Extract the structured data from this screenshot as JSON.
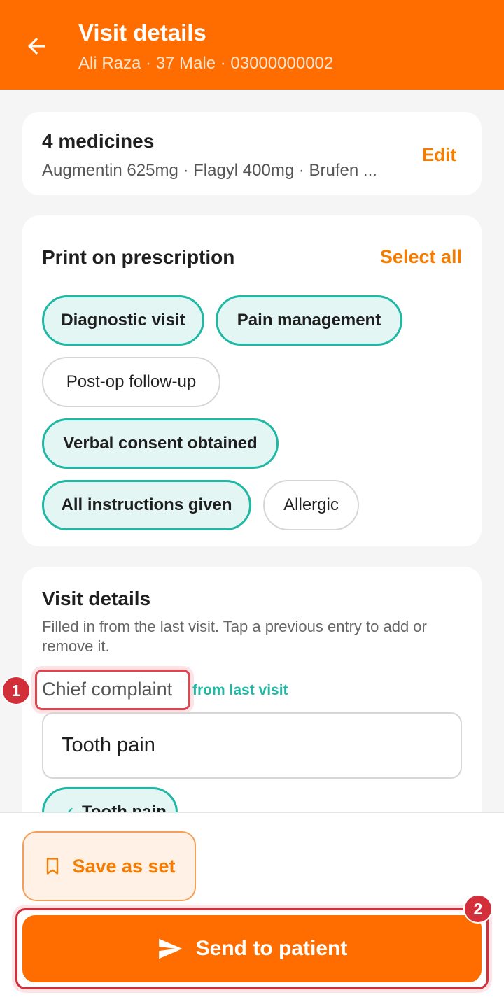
{
  "header": {
    "back_icon": "arrow-left-icon",
    "title": "Visit details",
    "subtitle": "Ali Raza · 37 Male · 03000000002"
  },
  "medicines": {
    "count_label": "4 medicines",
    "list": "Augmentin 625mg · Flagyl 400mg · Brufen ...",
    "edit_label": "Edit"
  },
  "print": {
    "title": "Print on prescription",
    "select_all_label": "Select all",
    "chips": [
      {
        "label": "Diagnostic visit",
        "selected": true
      },
      {
        "label": "Pain management",
        "selected": true
      },
      {
        "label": "Post-op follow-up",
        "selected": false
      },
      {
        "label": "Verbal consent obtained",
        "selected": true
      },
      {
        "label": "All instructions given",
        "selected": true
      },
      {
        "label": "Allergic",
        "selected": false
      }
    ]
  },
  "visit": {
    "title": "Visit details",
    "help": "Filled in from the last visit. Tap a previous entry to add or remove it.",
    "chief_complaint_label": "Chief complaint",
    "from_last_visit": "from last visit",
    "chief_complaint_value": "Tooth pain",
    "previous_entries": [
      {
        "label": "Tooth pain",
        "icon": "check-icon"
      }
    ]
  },
  "actions": {
    "save_set_label": "Save as set",
    "save_set_icon": "bookmark-icon",
    "send_label": "Send to patient",
    "send_icon": "send-icon"
  },
  "annotations": {
    "badge_1": "1",
    "badge_2": "2"
  },
  "colors": {
    "primary": "#ff6d00",
    "accent_text": "#f57c00",
    "teal": "#1fb8a4",
    "teal_bg": "#e3f6f3",
    "badge_red": "#d32f3a"
  }
}
